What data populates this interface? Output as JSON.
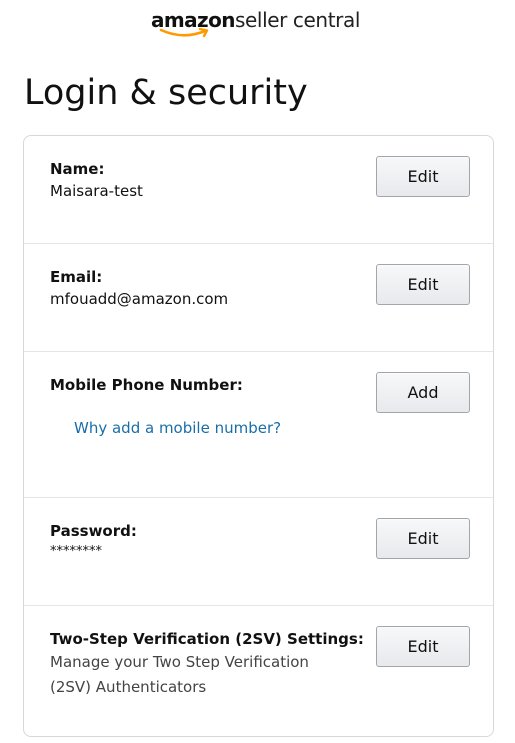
{
  "header": {
    "logo_brand": "amazon",
    "logo_product": "seller central",
    "logo_smile_color": "#ff9900"
  },
  "page": {
    "title": "Login & security"
  },
  "sections": [
    {
      "label": "Name:",
      "value": "Maisara-test",
      "button_label": "Edit"
    },
    {
      "label": "Email:",
      "value": "mfouadd@amazon.com",
      "button_label": "Edit"
    },
    {
      "label": "Mobile Phone Number:",
      "link_text": "Why add a mobile number?",
      "button_label": "Add"
    },
    {
      "label": "Password:",
      "value": "********",
      "button_label": "Edit"
    },
    {
      "label": "Two-Step Verification (2SV) Settings:",
      "description": "Manage your Two Step Verification (2SV) Authenticators",
      "button_label": "Edit"
    }
  ],
  "colors": {
    "link": "#1a6ea8",
    "card_border": "#d5d9d9",
    "divider": "#e3e6e6",
    "button_border": "#a2a6ac"
  }
}
